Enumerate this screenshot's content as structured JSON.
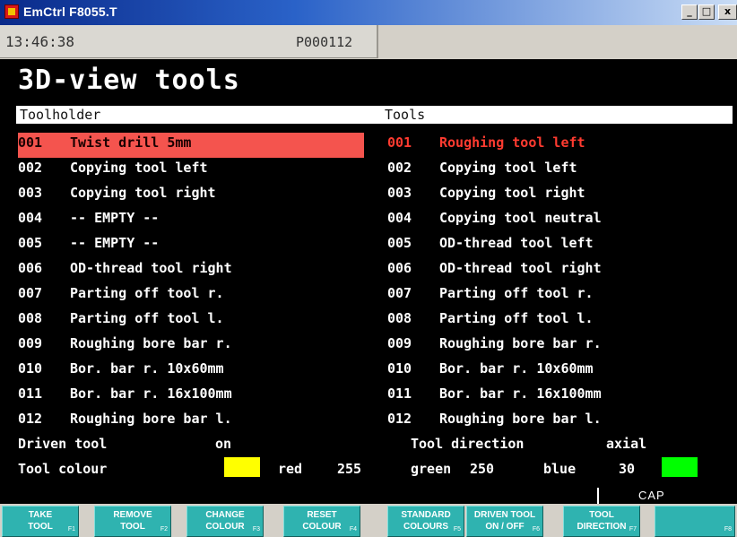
{
  "window": {
    "title": "EmCtrl F8055.T",
    "controls": {
      "minimize": "_",
      "maximize": "□",
      "close": "x"
    }
  },
  "status": {
    "clock": "13:46:38",
    "program": "P000112"
  },
  "page": {
    "title": "3D-view tools"
  },
  "headers": {
    "left": "Toolholder",
    "right": "Tools"
  },
  "toolholder": [
    {
      "num": "001",
      "name": "Twist drill 5mm"
    },
    {
      "num": "002",
      "name": "Copying tool left"
    },
    {
      "num": "003",
      "name": "Copying tool right"
    },
    {
      "num": "004",
      "name": "-- EMPTY --"
    },
    {
      "num": "005",
      "name": "-- EMPTY --"
    },
    {
      "num": "006",
      "name": "OD-thread tool right"
    },
    {
      "num": "007",
      "name": "Parting off tool r."
    },
    {
      "num": "008",
      "name": "Parting off tool l."
    },
    {
      "num": "009",
      "name": "Roughing bore bar r."
    },
    {
      "num": "010",
      "name": "Bor. bar r. 10x60mm"
    },
    {
      "num": "011",
      "name": "Bor. bar r. 16x100mm"
    },
    {
      "num": "012",
      "name": "Roughing bore bar l."
    }
  ],
  "tools": [
    {
      "num": "001",
      "name": "Roughing tool left"
    },
    {
      "num": "002",
      "name": "Copying tool left"
    },
    {
      "num": "003",
      "name": "Copying tool right"
    },
    {
      "num": "004",
      "name": "Copying tool neutral"
    },
    {
      "num": "005",
      "name": "OD-thread tool left"
    },
    {
      "num": "006",
      "name": "OD-thread tool right"
    },
    {
      "num": "007",
      "name": "Parting off tool r."
    },
    {
      "num": "008",
      "name": "Parting off tool l."
    },
    {
      "num": "009",
      "name": "Roughing bore bar r."
    },
    {
      "num": "010",
      "name": "Bor. bar r. 10x60mm"
    },
    {
      "num": "011",
      "name": "Bor. bar r. 16x100mm"
    },
    {
      "num": "012",
      "name": "Roughing bore bar l."
    }
  ],
  "fields": {
    "driven_tool_label": "Driven tool",
    "driven_tool_value": "on",
    "tool_direction_label": "Tool direction",
    "tool_direction_value": "axial",
    "tool_colour_label": "Tool colour",
    "red_label": "red",
    "red_value": "255",
    "green_label": "green",
    "green_value": "250",
    "blue_label": "blue",
    "blue_value": "30"
  },
  "colors": {
    "selection_bg": "#f4544e",
    "selection_text": "#ff3b30",
    "swatch_yellow": "#ffff00",
    "swatch_green": "#00ff00",
    "softkey": "#2fb3b0"
  },
  "cap": "CAP",
  "softkeys": [
    {
      "line1": "TAKE",
      "line2": "TOOL",
      "fkey": "F1"
    },
    {
      "line1": "REMOVE",
      "line2": "TOOL",
      "fkey": "F2"
    },
    {
      "line1": "CHANGE",
      "line2": "COLOUR",
      "fkey": "F3"
    },
    {
      "line1": "RESET",
      "line2": "COLOUR",
      "fkey": "F4"
    },
    {
      "line1": "STANDARD",
      "line2": "COLOURS",
      "fkey": "F5"
    },
    {
      "line1": "DRIVEN TOOL",
      "line2": "ON / OFF",
      "fkey": "F6"
    },
    {
      "line1": "TOOL",
      "line2": "DIRECTION",
      "fkey": "F7"
    },
    {
      "line1": "",
      "line2": "",
      "fkey": "F8"
    }
  ]
}
